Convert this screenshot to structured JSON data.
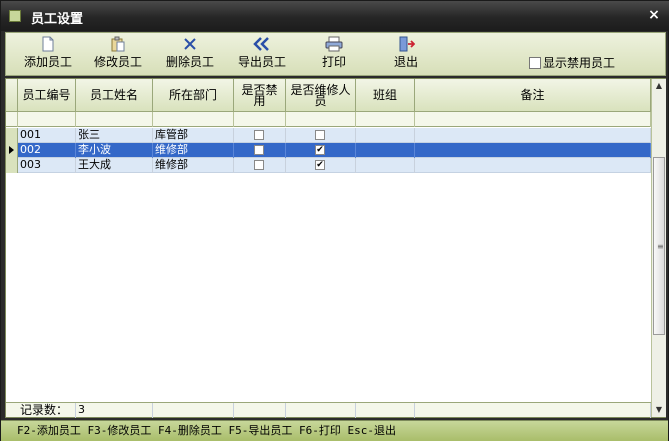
{
  "window": {
    "title": "员工设置",
    "close": "×"
  },
  "toolbar": {
    "buttons": [
      {
        "label": "添加员工",
        "icon": "new-document-icon"
      },
      {
        "label": "修改员工",
        "icon": "edit-clipboard-icon"
      },
      {
        "label": "删除员工",
        "icon": "delete-x-icon"
      },
      {
        "label": "导出员工",
        "icon": "export-arrows-icon"
      },
      {
        "label": "打印",
        "icon": "printer-icon"
      },
      {
        "label": "退出",
        "icon": "exit-door-icon"
      }
    ],
    "show_disabled_label": "显示禁用员工",
    "show_disabled_checked": false
  },
  "grid": {
    "columns": [
      "员工编号",
      "员工姓名",
      "所在部门",
      "是否禁用",
      "是否维修人员",
      "班组",
      "备注"
    ],
    "rows": [
      {
        "id": "001",
        "name": "张三",
        "dept": "库管部",
        "disabled": false,
        "repair": false,
        "team": "",
        "note": ""
      },
      {
        "id": "002",
        "name": "李小波",
        "dept": "维修部",
        "disabled": false,
        "repair": true,
        "team": "",
        "note": ""
      },
      {
        "id": "003",
        "name": "王大成",
        "dept": "维修部",
        "disabled": false,
        "repair": true,
        "team": "",
        "note": ""
      }
    ],
    "selected_index": 1,
    "footer_label": "记录数：",
    "record_count": "3"
  },
  "statusbar": {
    "text": "F2-添加员工 F3-修改员工 F4-删除员工 F5-导出员工 F6-打印 Esc-退出"
  },
  "colors": {
    "selected_row": "#3468c8",
    "row_bg": "#dce8f6",
    "accent": "#c7d79a"
  }
}
